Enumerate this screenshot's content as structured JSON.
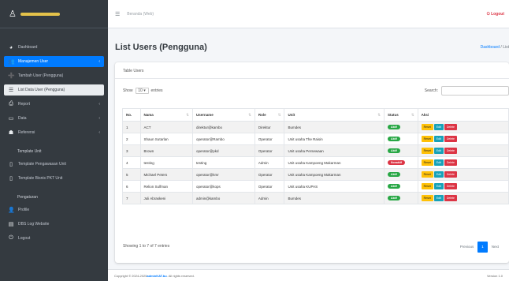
{
  "sidebar": {
    "brand": "adminKambo",
    "items": [
      {
        "icon": "dashboard-icon",
        "glyph": "◕",
        "label": "Dashboard",
        "caret": ""
      },
      {
        "icon": "users-icon",
        "glyph": "👥",
        "label": "Manajemen User",
        "caret": "‹"
      },
      {
        "icon": "user-plus-icon",
        "glyph": "➕",
        "label": "Tambah User (Pengguna)",
        "caret": ""
      },
      {
        "icon": "list-icon",
        "glyph": "☰",
        "label": "List Data User (Pengguna)",
        "caret": ""
      },
      {
        "icon": "printer-icon",
        "glyph": "⎙",
        "label": "Report",
        "caret": "‹"
      },
      {
        "icon": "database-icon",
        "glyph": "▭",
        "label": "Data",
        "caret": "‹"
      },
      {
        "icon": "group-icon",
        "glyph": "☗",
        "label": "Referensi",
        "caret": "‹"
      }
    ],
    "section1": "Template Unit",
    "section1_items": [
      {
        "icon": "file-icon",
        "glyph": "▯",
        "label": "Template Pengawasan Unit"
      },
      {
        "icon": "file-icon",
        "glyph": "▯",
        "label": "Template Bisnis PKT Unit"
      }
    ],
    "section2": "Pengaturan",
    "section2_items": [
      {
        "icon": "profile-icon",
        "glyph": "👤",
        "label": "Profile"
      },
      {
        "icon": "log-icon",
        "glyph": "▤",
        "label": "DBS Log Website"
      },
      {
        "icon": "logout-icon",
        "glyph": "⏻",
        "label": "Logout"
      }
    ]
  },
  "navbar": {
    "home": "Beranda (Web)",
    "logout": "Logout"
  },
  "header": {
    "title": "List Users (Pengguna)",
    "breadcrumb_home": "Dashboard",
    "breadcrumb_sep": " / ",
    "breadcrumb_current": "List"
  },
  "card": {
    "title": "Table Users",
    "show_label": "Show",
    "entries_value": "10",
    "entries_label": "entries",
    "search_label": "Search:",
    "search_value": ""
  },
  "table": {
    "headers": [
      "No.",
      "Nama",
      "Username",
      "Role",
      "Unit",
      "Status",
      "Aksi"
    ],
    "rows": [
      {
        "no": "1",
        "name": "ACT",
        "username": "direktur@kambo",
        "role": "Direktur",
        "unit": "Bumdes",
        "status": "Aktif"
      },
      {
        "no": "2",
        "name": "Shaun Sutarlan",
        "username": "operator@Rambo",
        "role": "Operator",
        "unit": "Unit usaha The Raisin",
        "status": "Aktif"
      },
      {
        "no": "3",
        "name": "Brown",
        "username": "operator@pkd",
        "role": "Operator",
        "unit": "Unit usaha Persewaan",
        "status": "Aktif"
      },
      {
        "no": "4",
        "name": "testing",
        "username": "testing",
        "role": "Admin",
        "unit": "Unit usaha Kampoeng Makarman",
        "status": "Nonaktif"
      },
      {
        "no": "5",
        "name": "Michael Peters",
        "username": "operator@kmr",
        "role": "Operator",
        "unit": "Unit usaha Kampoeng Makarman",
        "status": "Aktif"
      },
      {
        "no": "6",
        "name": "Relion Sulfman",
        "username": "operator@kops",
        "role": "Operator",
        "unit": "Unit usaha KUPAS",
        "status": "Aktif"
      },
      {
        "no": "7",
        "name": "Juli Abraskeni",
        "username": "admin@kambo",
        "role": "Admin",
        "unit": "Bumdes",
        "status": "Aktif"
      }
    ],
    "actions": {
      "reset": "Reset",
      "edit": "Edit",
      "delete": "Delete"
    }
  },
  "footer_info": "Showing 1 to 7 of 7 entries",
  "pager": {
    "prev": "Previous",
    "current": "1",
    "next": "Next"
  },
  "main_footer": {
    "copyright": "Copyright © 2024-2025 ",
    "link": "adminKAT.bu",
    "rights": ". All rights reserved.",
    "version": "Version 1.0"
  },
  "colors": {
    "primary": "#007bff",
    "sidebar": "#343a40",
    "success": "#28a745",
    "danger": "#dc3545",
    "warning": "#ffc107",
    "info": "#17a2b8"
  }
}
